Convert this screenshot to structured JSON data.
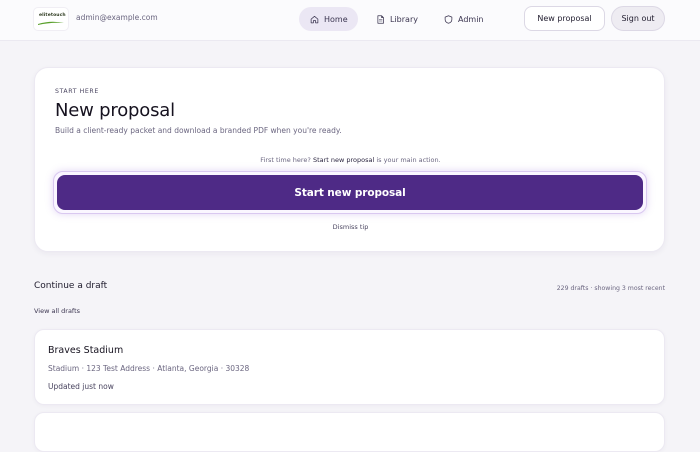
{
  "header": {
    "logo_text": "elitetouch",
    "user_email": "admin@example.com",
    "nav": [
      {
        "label": "Home",
        "icon": "home-icon",
        "active": true
      },
      {
        "label": "Library",
        "icon": "document-icon",
        "active": false
      },
      {
        "label": "Admin",
        "icon": "shield-icon",
        "active": false
      }
    ],
    "new_proposal_label": "New proposal",
    "sign_out_label": "Sign out"
  },
  "hero": {
    "eyebrow": "START HERE",
    "title": "New proposal",
    "description": "Build a client-ready packet and download a branded PDF when you're ready.",
    "hint_prefix": "First time here? ",
    "hint_emphasis": "Start new proposal",
    "hint_suffix": " is your main action.",
    "cta_label": "Start new proposal",
    "dismiss_label": "Dismiss tip"
  },
  "drafts": {
    "section_title": "Continue a draft",
    "count_text": "229 drafts · showing 3 most recent",
    "view_all_label": "View all drafts",
    "items": [
      {
        "name": "Braves Stadium",
        "meta": "Stadium · 123 Test Address · Atlanta, Georgia · 30328",
        "updated": "Updated just now"
      }
    ]
  },
  "colors": {
    "accent": "#4e2a86",
    "page_bg": "#f5f4f8",
    "nav_active_bg": "#ebe7f4"
  }
}
